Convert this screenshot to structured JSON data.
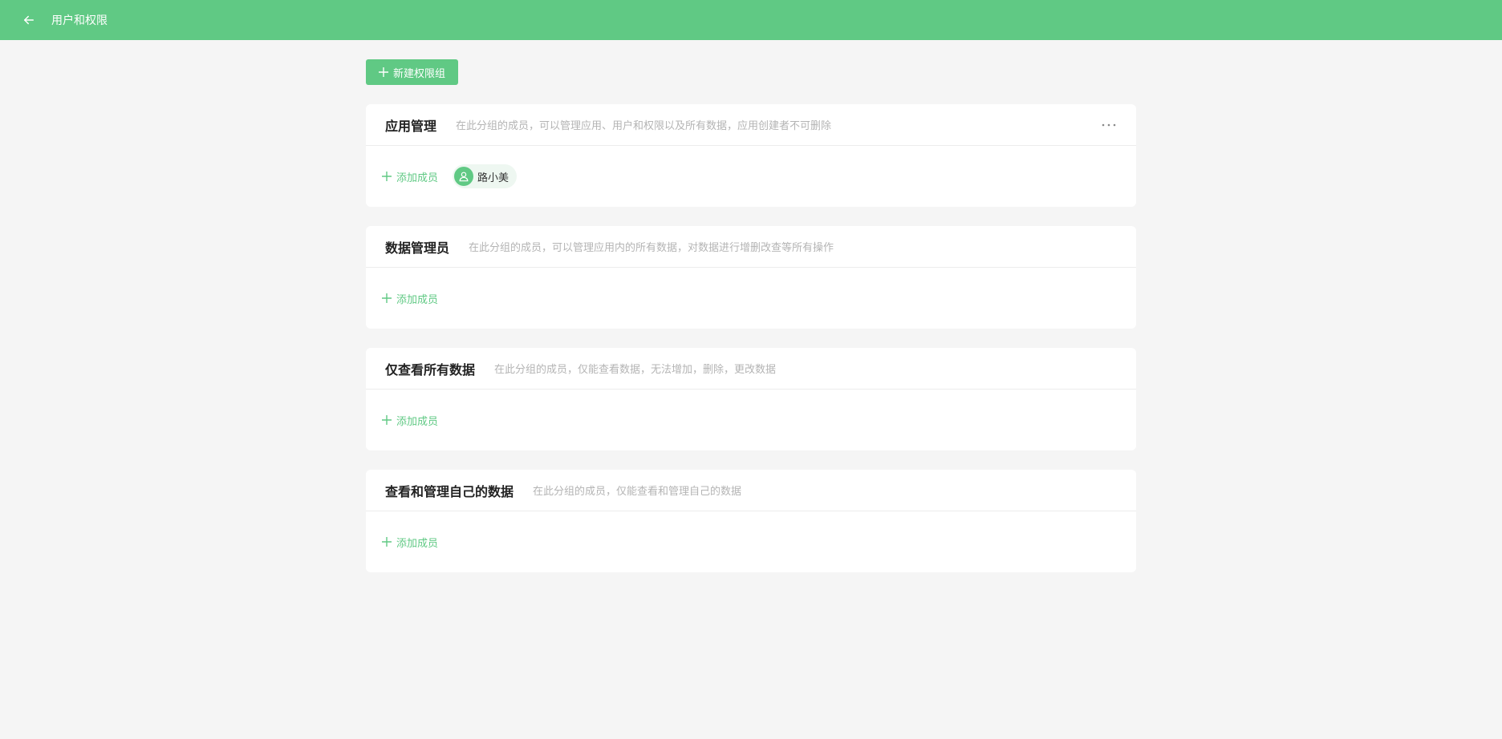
{
  "colors": {
    "brand": "#60c984",
    "background": "#f5f5f5",
    "description": "#b4b4b4"
  },
  "header": {
    "back_icon": "arrow-left-icon",
    "title": "用户和权限"
  },
  "toolbar": {
    "new_group_label": "新建权限组",
    "new_group_icon": "plus-icon"
  },
  "groups": [
    {
      "name": "应用管理",
      "description": "在此分组的成员，可以管理应用、用户和权限以及所有数据，应用创建者不可删除",
      "has_more": true,
      "add_label": "添加成员",
      "members": [
        {
          "name": "路小美",
          "icon": "user-icon"
        }
      ]
    },
    {
      "name": "数据管理员",
      "description": "在此分组的成员，可以管理应用内的所有数据，对数据进行增删改查等所有操作",
      "add_label": "添加成员",
      "members": []
    },
    {
      "name": "仅查看所有数据",
      "description": "在此分组的成员，仅能查看数据，无法增加，删除，更改数据",
      "add_label": "添加成员",
      "members": []
    },
    {
      "name": "查看和管理自己的数据",
      "description": "在此分组的成员，仅能查看和管理自己的数据",
      "add_label": "添加成员",
      "members": []
    }
  ],
  "more_icon": "more-horizontal-icon"
}
